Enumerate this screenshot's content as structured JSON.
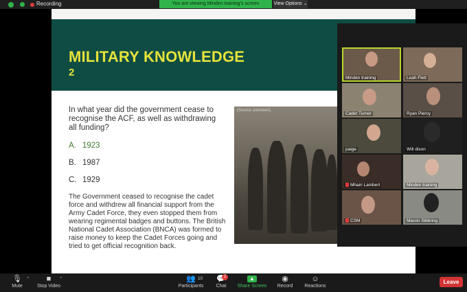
{
  "topbar": {
    "recording_label": "Recording",
    "viewing_banner": "You are viewing Minden training's screen",
    "view_options": "View Options ⌄"
  },
  "slide": {
    "title": "MILITARY KNOWLEDGE",
    "subtitle": "2",
    "question": "In what year did the government cease to recognise the ACF, as well as withdrawing all funding?",
    "options": [
      {
        "letter": "A.",
        "text": "1923"
      },
      {
        "letter": "B.",
        "text": "1987"
      },
      {
        "letter": "C.",
        "text": "1929"
      }
    ],
    "answer": "The Government ceased to recognise the cadet force and withdrew all financial support from the Army Cadet Force, they even stopped them from wearing regimental badges and buttons. The British National Cadet Association (BNCA) was formed to raise money to keep the Cadet Forces going and tried to get official recognition back.",
    "photo_caption": "(Source unknown)"
  },
  "participants": [
    {
      "name": "Minden training",
      "muted": false,
      "active": true
    },
    {
      "name": "Leah Flett",
      "muted": false,
      "active": false
    },
    {
      "name": "Cadet Turner",
      "muted": false,
      "active": false
    },
    {
      "name": "Ryan Piercy",
      "muted": false,
      "active": false
    },
    {
      "name": "paige",
      "muted": false,
      "active": false
    },
    {
      "name": "Will dixon",
      "muted": false,
      "active": false
    },
    {
      "name": "Mhairi Lambert",
      "muted": true,
      "active": false
    },
    {
      "name": "Minden training",
      "muted": false,
      "active": false
    },
    {
      "name": "CSM",
      "muted": true,
      "active": false
    },
    {
      "name": "Mason Sibbring",
      "muted": false,
      "active": false
    }
  ],
  "toolbar": {
    "mute": "Mute",
    "stop_video": "Stop Video",
    "participants": "Participants",
    "participants_count": "10",
    "chat": "Chat",
    "chat_badge": "2",
    "share_screen": "Share Screen",
    "record": "Record",
    "reactions": "Reactions",
    "leave": "Leave"
  },
  "colors": {
    "slide_header": "#0f4d44",
    "title_yellow": "#e7e33b",
    "share_green": "#2fb34a",
    "leave_red": "#d23434",
    "active_speaker": "#b8d62a"
  }
}
